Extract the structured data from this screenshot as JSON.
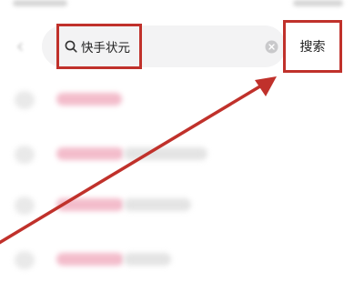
{
  "search": {
    "query": "快手状元",
    "button_label": "搜索"
  },
  "history": {
    "items": [
      {
        "label": ""
      },
      {
        "label": ""
      },
      {
        "label": ""
      },
      {
        "label": ""
      },
      {
        "label": ""
      }
    ]
  },
  "annotation": {
    "highlight_color": "#c0312b",
    "arrow_color": "#c0312b"
  }
}
